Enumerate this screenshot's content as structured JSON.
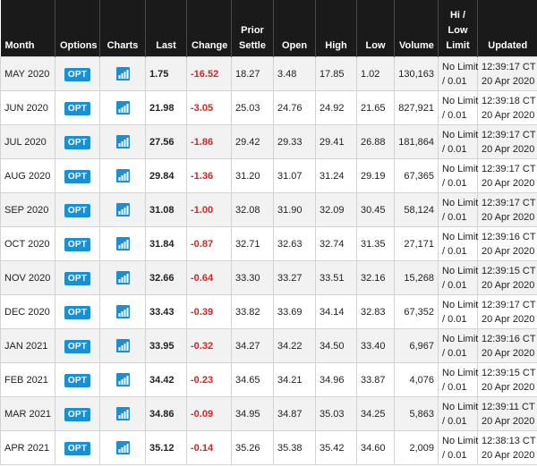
{
  "headers": {
    "month": "Month",
    "options": "Options",
    "charts": "Charts",
    "last": "Last",
    "change": "Change",
    "prior_settle_line1": "Prior",
    "prior_settle_line2": "Settle",
    "open": "Open",
    "high": "High",
    "low": "Low",
    "volume": "Volume",
    "hilo_line1": "Hi /",
    "hilo_line2": "Low",
    "hilo_line3": "Limit",
    "updated": "Updated"
  },
  "icons": {
    "options": "opt-button",
    "charts": "bar-chart-icon"
  },
  "colors": {
    "header_bg": "#1a1a1a",
    "accent": "#1b8fcf",
    "negative": "#e0201e",
    "alt_row": "#f2f2f2"
  },
  "rows": [
    {
      "month": "MAY 2020",
      "opt": "OPT",
      "last": "1.75",
      "change": "-16.52",
      "prior": "18.27",
      "open": "3.48",
      "high": "17.85",
      "low": "1.02",
      "volume": "130,163",
      "limit1": "No Limit",
      "limit2": "/ 0.01",
      "time": "12:39:17 CT",
      "date": "20 Apr 2020"
    },
    {
      "month": "JUN 2020",
      "opt": "OPT",
      "last": "21.98",
      "change": "-3.05",
      "prior": "25.03",
      "open": "24.76",
      "high": "24.92",
      "low": "21.65",
      "volume": "827,921",
      "limit1": "No Limit",
      "limit2": "/ 0.01",
      "time": "12:39:18 CT",
      "date": "20 Apr 2020"
    },
    {
      "month": "JUL 2020",
      "opt": "OPT",
      "last": "27.56",
      "change": "-1.86",
      "prior": "29.42",
      "open": "29.33",
      "high": "29.41",
      "low": "26.88",
      "volume": "181,864",
      "limit1": "No Limit",
      "limit2": "/ 0.01",
      "time": "12:39:17 CT",
      "date": "20 Apr 2020"
    },
    {
      "month": "AUG 2020",
      "opt": "OPT",
      "last": "29.84",
      "change": "-1.36",
      "prior": "31.20",
      "open": "31.07",
      "high": "31.24",
      "low": "29.19",
      "volume": "67,365",
      "limit1": "No Limit",
      "limit2": "/ 0.01",
      "time": "12:39:17 CT",
      "date": "20 Apr 2020"
    },
    {
      "month": "SEP 2020",
      "opt": "OPT",
      "last": "31.08",
      "change": "-1.00",
      "prior": "32.08",
      "open": "31.90",
      "high": "32.09",
      "low": "30.45",
      "volume": "58,124",
      "limit1": "No Limit",
      "limit2": "/ 0.01",
      "time": "12:39:17 CT",
      "date": "20 Apr 2020"
    },
    {
      "month": "OCT 2020",
      "opt": "OPT",
      "last": "31.84",
      "change": "-0.87",
      "prior": "32.71",
      "open": "32.63",
      "high": "32.74",
      "low": "31.35",
      "volume": "27,171",
      "limit1": "No Limit",
      "limit2": "/ 0.01",
      "time": "12:39:16 CT",
      "date": "20 Apr 2020"
    },
    {
      "month": "NOV 2020",
      "opt": "OPT",
      "last": "32.66",
      "change": "-0.64",
      "prior": "33.30",
      "open": "33.27",
      "high": "33.51",
      "low": "32.16",
      "volume": "15,268",
      "limit1": "No Limit",
      "limit2": "/ 0.01",
      "time": "12:39:15 CT",
      "date": "20 Apr 2020"
    },
    {
      "month": "DEC 2020",
      "opt": "OPT",
      "last": "33.43",
      "change": "-0.39",
      "prior": "33.82",
      "open": "33.69",
      "high": "34.14",
      "low": "32.83",
      "volume": "67,352",
      "limit1": "No Limit",
      "limit2": "/ 0.01",
      "time": "12:39:17 CT",
      "date": "20 Apr 2020"
    },
    {
      "month": "JAN 2021",
      "opt": "OPT",
      "last": "33.95",
      "change": "-0.32",
      "prior": "34.27",
      "open": "34.22",
      "high": "34.50",
      "low": "33.40",
      "volume": "6,967",
      "limit1": "No Limit",
      "limit2": "/ 0.01",
      "time": "12:39:16 CT",
      "date": "20 Apr 2020"
    },
    {
      "month": "FEB 2021",
      "opt": "OPT",
      "last": "34.42",
      "change": "-0.23",
      "prior": "34.65",
      "open": "34.21",
      "high": "34.96",
      "low": "33.87",
      "volume": "4,076",
      "limit1": "No Limit",
      "limit2": "/ 0.01",
      "time": "12:39:15 CT",
      "date": "20 Apr 2020"
    },
    {
      "month": "MAR 2021",
      "opt": "OPT",
      "last": "34.86",
      "change": "-0.09",
      "prior": "34.95",
      "open": "34.87",
      "high": "35.03",
      "low": "34.25",
      "volume": "5,863",
      "limit1": "No Limit",
      "limit2": "/ 0.01",
      "time": "12:39:11 CT",
      "date": "20 Apr 2020"
    },
    {
      "month": "APR 2021",
      "opt": "OPT",
      "last": "35.12",
      "change": "-0.14",
      "prior": "35.26",
      "open": "35.38",
      "high": "35.42",
      "low": "34.60",
      "volume": "2,009",
      "limit1": "No Limit",
      "limit2": "/ 0.01",
      "time": "12:38:13 CT",
      "date": "20 Apr 2020"
    }
  ]
}
